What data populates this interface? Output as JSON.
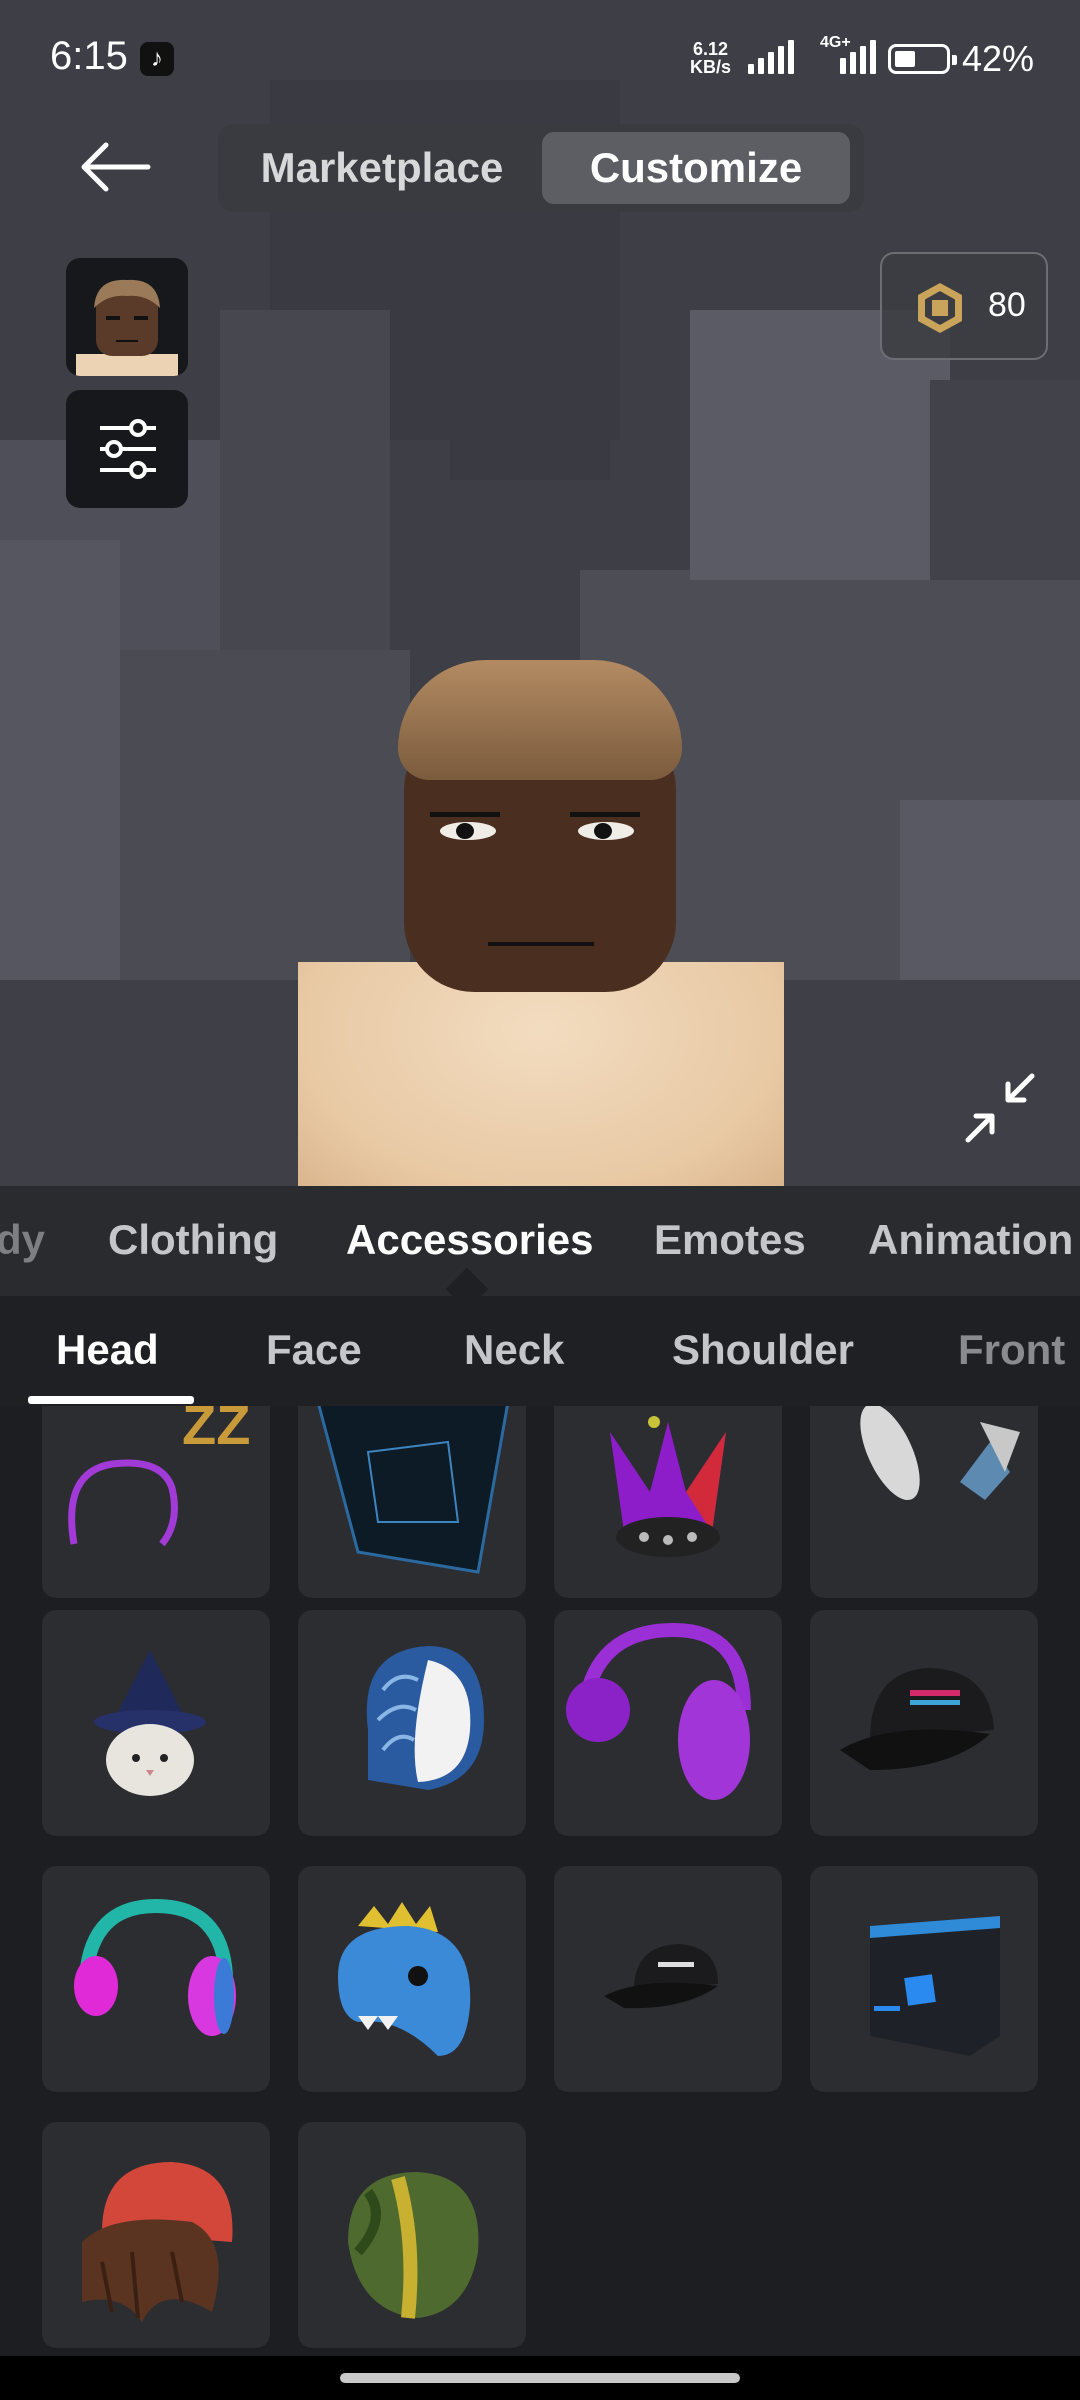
{
  "status_bar": {
    "time": "6:15",
    "net_speed_value": "6.12",
    "net_speed_unit": "KB/s",
    "network_type": "4G+",
    "battery_percent": "42%",
    "battery_level": 0.42
  },
  "top_nav": {
    "tabs": [
      {
        "label": "Marketplace",
        "selected": false
      },
      {
        "label": "Customize",
        "selected": true
      }
    ]
  },
  "currency": {
    "amount": "80",
    "icon": "robux-icon"
  },
  "categories": {
    "items": [
      "dy",
      "Clothing",
      "Accessories",
      "Emotes",
      "Animation"
    ],
    "selected": "Accessories"
  },
  "subcategories": {
    "items": [
      "Head",
      "Face",
      "Neck",
      "Shoulder",
      "Front"
    ],
    "selected": "Head"
  },
  "items": [
    {
      "icon": "zzz-headband-item"
    },
    {
      "icon": "dark-cube-hat-item"
    },
    {
      "icon": "spiked-crown-item"
    },
    {
      "icon": "bunny-ears-item"
    },
    {
      "icon": "cat-wizard-hat-item"
    },
    {
      "icon": "blue-hood-item"
    },
    {
      "icon": "purple-headphones-item"
    },
    {
      "icon": "black-cap-item"
    },
    {
      "icon": "neon-headphones-item"
    },
    {
      "icon": "blue-dino-hat-item"
    },
    {
      "icon": "roblox-cap-item"
    },
    {
      "icon": "blue-light-cube-item"
    },
    {
      "icon": "red-beanie-hair-item"
    },
    {
      "icon": "green-hood-item"
    }
  ],
  "colors": {
    "background": "#1d1e21",
    "tile": "#2c2d31",
    "accent_selected_tab": "#5c5e63"
  }
}
